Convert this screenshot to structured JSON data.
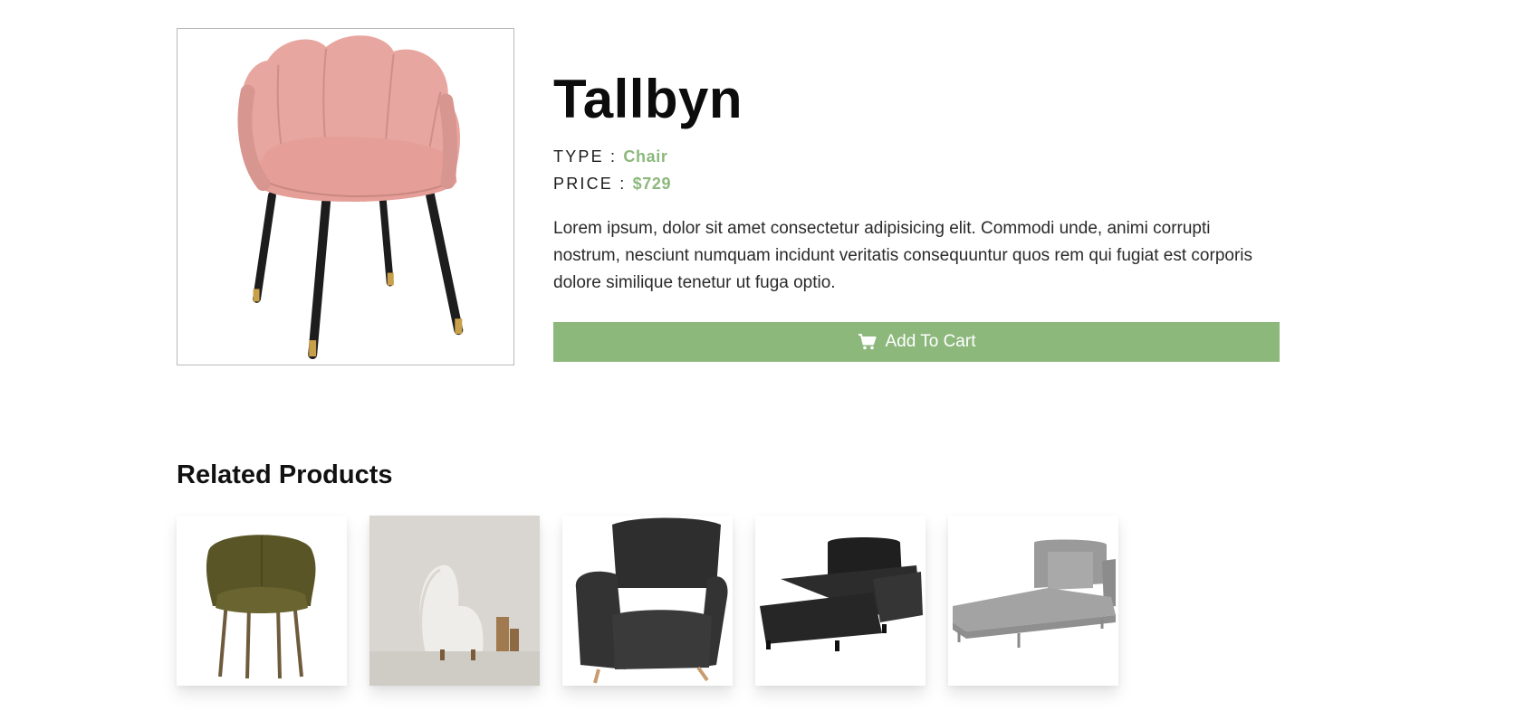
{
  "product": {
    "name": "Tallbyn",
    "type_label": "TYPE :",
    "type_value": "Chair",
    "price_label": "PRICE :",
    "price_value": "$729",
    "description": "Lorem ipsum, dolor sit amet consectetur adipisicing elit. Commodi unde, animi corrupti nostrum, nesciunt numquam incidunt veritatis consequuntur quos rem qui fugiat est corporis dolore similique tenetur ut fuga optio.",
    "add_to_cart_label": "Add To Cart",
    "image_icon": "pink-scalloped-chair-image"
  },
  "related": {
    "title": "Related Products",
    "items": [
      {
        "icon": "olive-armchair-image"
      },
      {
        "icon": "white-lounge-chair-image"
      },
      {
        "icon": "black-wingback-armchair-image"
      },
      {
        "icon": "black-chaise-sofa-image"
      },
      {
        "icon": "grey-chaise-lounge-image"
      }
    ]
  },
  "colors": {
    "accent": "#8db87c",
    "text": "#111111"
  }
}
